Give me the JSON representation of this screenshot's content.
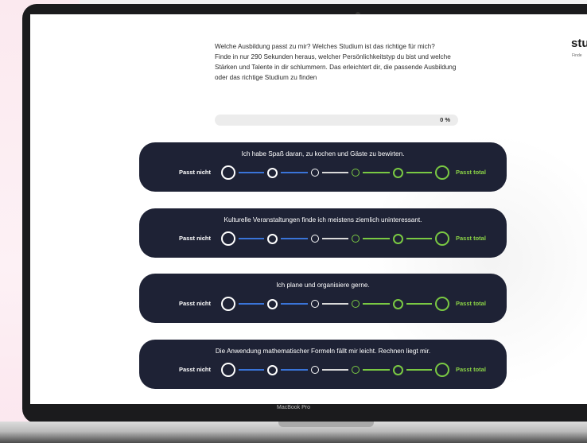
{
  "intro": {
    "line1": "Welche Ausbildung passt zu mir? Welches Studium ist das richtige für mich?",
    "line2": "Finde in nur 290 Sekunden heraus, welcher Persönlichkeitstyp du bist und welche Stärken und Talente in dir schlummern. Das erleichtert dir, die passende Ausbildung oder das richtige Studium zu finden"
  },
  "brand": {
    "name": "stu",
    "sub": "Finde"
  },
  "progress": {
    "value": 0,
    "label": "0 %"
  },
  "scale": {
    "left_label": "Passt nicht",
    "right_label": "Passt total",
    "options": 6
  },
  "questions": [
    {
      "text": "Ich habe Spaß daran, zu kochen und Gäste zu bewirten."
    },
    {
      "text": "Kulturelle Veranstaltungen finde ich meistens ziemlich uninteressant."
    },
    {
      "text": "Ich plane und organisiere gerne."
    },
    {
      "text": "Die Anwendung mathematischer Formeln fällt mir leicht. Rechnen liegt mir."
    }
  ],
  "device": {
    "label": "MacBook Pro"
  },
  "colors": {
    "card_bg": "#1e2235",
    "left_side": "#ffffff",
    "left_lines": "#3a74d8",
    "right_side": "#7ac943"
  }
}
